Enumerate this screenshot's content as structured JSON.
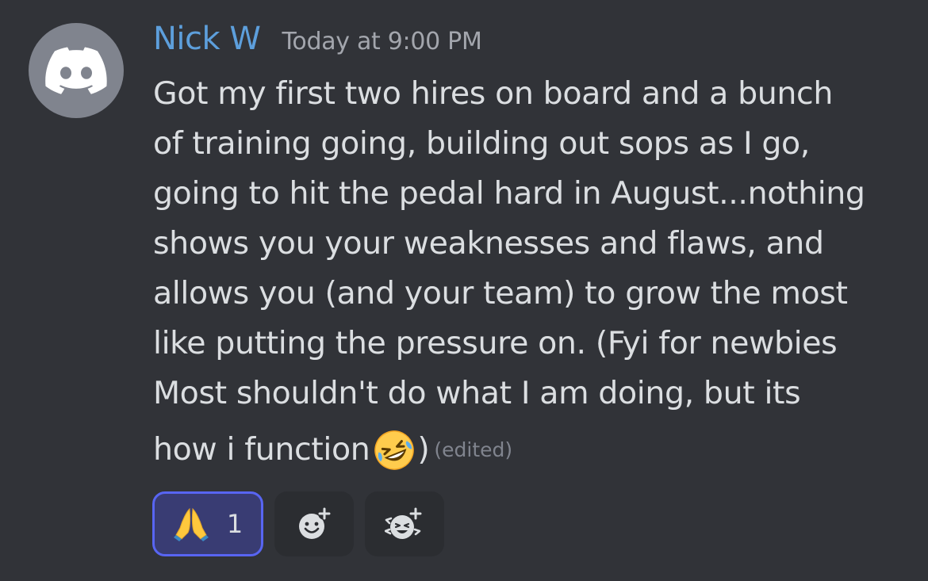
{
  "message": {
    "author": "Nick W",
    "timestamp": "Today at 9:00 PM",
    "lines": [
      "Got my first two hires on board and a bunch",
      "of training going, building out sops as I go,",
      "going to hit the pedal hard in August...nothing",
      "shows you your weaknesses and flaws, and",
      "allows you (and your team) to grow the most",
      "like putting the pressure on. (Fyi for newbies",
      "Most shouldn't do what I am doing, but its"
    ],
    "last_line_text": "how i function",
    "last_line_close": ")",
    "edited_label": "(edited)",
    "inline_emoji": "rolling-on-floor-laughing-emoji"
  },
  "reactions": [
    {
      "emoji": "folded-hands-emoji",
      "count": "1",
      "active": true
    },
    {
      "icon": "add-reaction-icon"
    },
    {
      "icon": "add-super-reaction-icon"
    }
  ],
  "colors": {
    "background": "#313338",
    "username": "#5d9fdc",
    "text": "#dbdee1",
    "muted": "#a3a6ad",
    "reaction_active_bg": "#393c73",
    "reaction_active_border": "#5865f2",
    "reaction_bg": "#2b2d31",
    "avatar_bg": "#80848e"
  }
}
